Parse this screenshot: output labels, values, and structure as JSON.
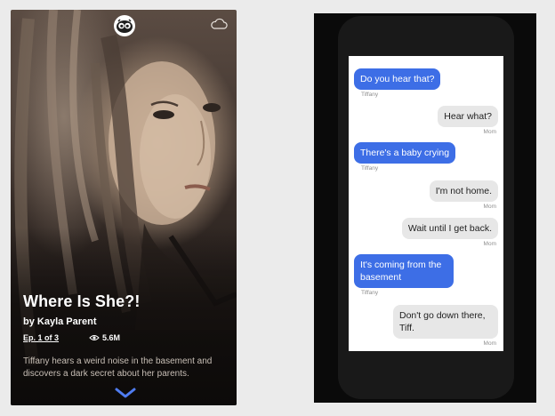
{
  "story": {
    "title": "Where Is She?!",
    "author": "by Kayla Parent",
    "episode": "Ep. 1 of 3",
    "views": "5.6M",
    "description": "Tiffany hears a weird noise in the basement and discovers a dark secret about her parents.",
    "logo_icon": "owl-icon",
    "cloud_icon": "cloud-icon",
    "next_icon": "chevron-down-icon"
  },
  "chat": {
    "messages": [
      {
        "side": "left",
        "text": "Do you hear that?",
        "sender": "Tiffany"
      },
      {
        "side": "right",
        "text": "Hear what?",
        "sender": "Mom"
      },
      {
        "side": "left",
        "text": "There's a baby crying",
        "sender": "Tiffany"
      },
      {
        "side": "right",
        "text": "I'm not home.",
        "sender": "Mom"
      },
      {
        "side": "right",
        "text": "Wait until I get back.",
        "sender": "Mom"
      },
      {
        "side": "left",
        "text": "It's coming from the basement",
        "sender": "Tiffany"
      },
      {
        "side": "right",
        "text": "Don't go down there, Tiff.",
        "sender": "Mom"
      }
    ]
  },
  "colors": {
    "sent_bubble": "#3d6ee6",
    "received_bubble": "#e7e7e7",
    "chevron": "#4f7cf0"
  }
}
